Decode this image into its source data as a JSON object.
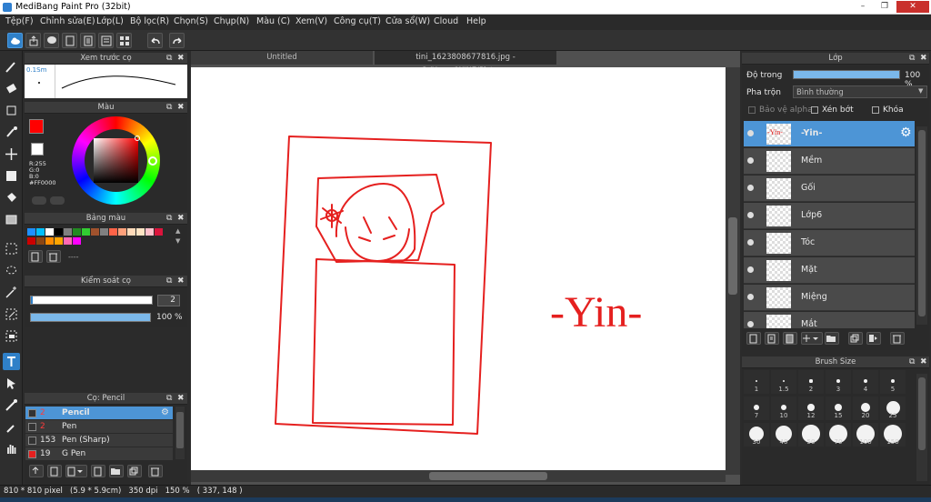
{
  "window": {
    "title": "MediBang Paint Pro (32bit)"
  },
  "menu": [
    "Tệp(F)",
    "Chỉnh sửa(E)",
    "Lớp(L)",
    "Bộ lọc(R)",
    "Chọn(S)",
    "Chụp(N)",
    "Màu (C)",
    "Xem(V)",
    "Công cụ(T)",
    "Cửa sổ(W)",
    "Cloud",
    "Help"
  ],
  "preview_panel": {
    "title": "Xem trước cọ",
    "size": "0.1Sm"
  },
  "color_panel": {
    "title": "Màu",
    "r": "R:255",
    "g": "G:0",
    "b": "B:0",
    "hex": "#FF0000",
    "current": "#ff0000"
  },
  "palette_panel": {
    "title": "Bảng màu",
    "extra": "----",
    "colors": [
      "#1e90ff",
      "#00bfff",
      "#ffffff",
      "#000000",
      "#7f7f7f",
      "#228b22",
      "#32cd32",
      "#a0522d",
      "#808080",
      "#ff6347",
      "#ffa07a",
      "#ffdab9",
      "#ffe4c4",
      "#ffc0cb",
      "#dc143c",
      "#cc0000",
      "#8b4513",
      "#ff8c00",
      "#ffa500",
      "#ff69b4",
      "#ff00ff"
    ]
  },
  "control_panel": {
    "title": "Kiểm soát cọ",
    "size_value": "2",
    "opacity_value": "100 %",
    "opacity": 1.0
  },
  "brush_panel": {
    "title": "Cọ: Pencil",
    "items": [
      {
        "size": "2",
        "name": "Pencil",
        "selected": true
      },
      {
        "size": "2",
        "name": "Pen",
        "selected": false
      },
      {
        "size": "153",
        "name": "Pen (Sharp)",
        "selected": false
      },
      {
        "size": "19",
        "name": "G Pen",
        "selected": false
      }
    ]
  },
  "tabs": {
    "untitled": "Untitled",
    "file": "tini_1623808677816.jpg - C:/Users/WIN7/Pictures"
  },
  "canvas": {
    "text": "-Yin-",
    "stroke": "#e5201f"
  },
  "layer_panel": {
    "title": "Lớp",
    "opacity_label": "Độ trong",
    "opacity_value": "100 %",
    "opacity": 1.0,
    "blend_label": "Pha trộn",
    "blend_value": "Bình thường",
    "protect_alpha": "Bảo vệ alpha",
    "clipping": "Xén bớt",
    "lock": "Khóa",
    "layers": [
      {
        "name": "-Yin-",
        "selected": true,
        "thumb_text": "-Yin-"
      },
      {
        "name": "Mềm",
        "selected": false
      },
      {
        "name": "Gối",
        "selected": false
      },
      {
        "name": "Lớp6",
        "selected": false
      },
      {
        "name": "Tóc",
        "selected": false
      },
      {
        "name": "Mặt",
        "selected": false
      },
      {
        "name": "Miệng",
        "selected": false
      },
      {
        "name": "Mắt",
        "selected": false
      }
    ]
  },
  "brush_size_panel": {
    "title": "Brush Size",
    "sizes": [
      "1",
      "1.5",
      "2",
      "3",
      "4",
      "5",
      "7",
      "10",
      "12",
      "15",
      "20",
      "25",
      "30",
      "40",
      "50",
      "70",
      "100",
      "150"
    ]
  },
  "status": {
    "text": "810 * 810 pixel   (5.9 * 5.9cm)   350 dpi   150 %   ( 337, 148 )"
  }
}
